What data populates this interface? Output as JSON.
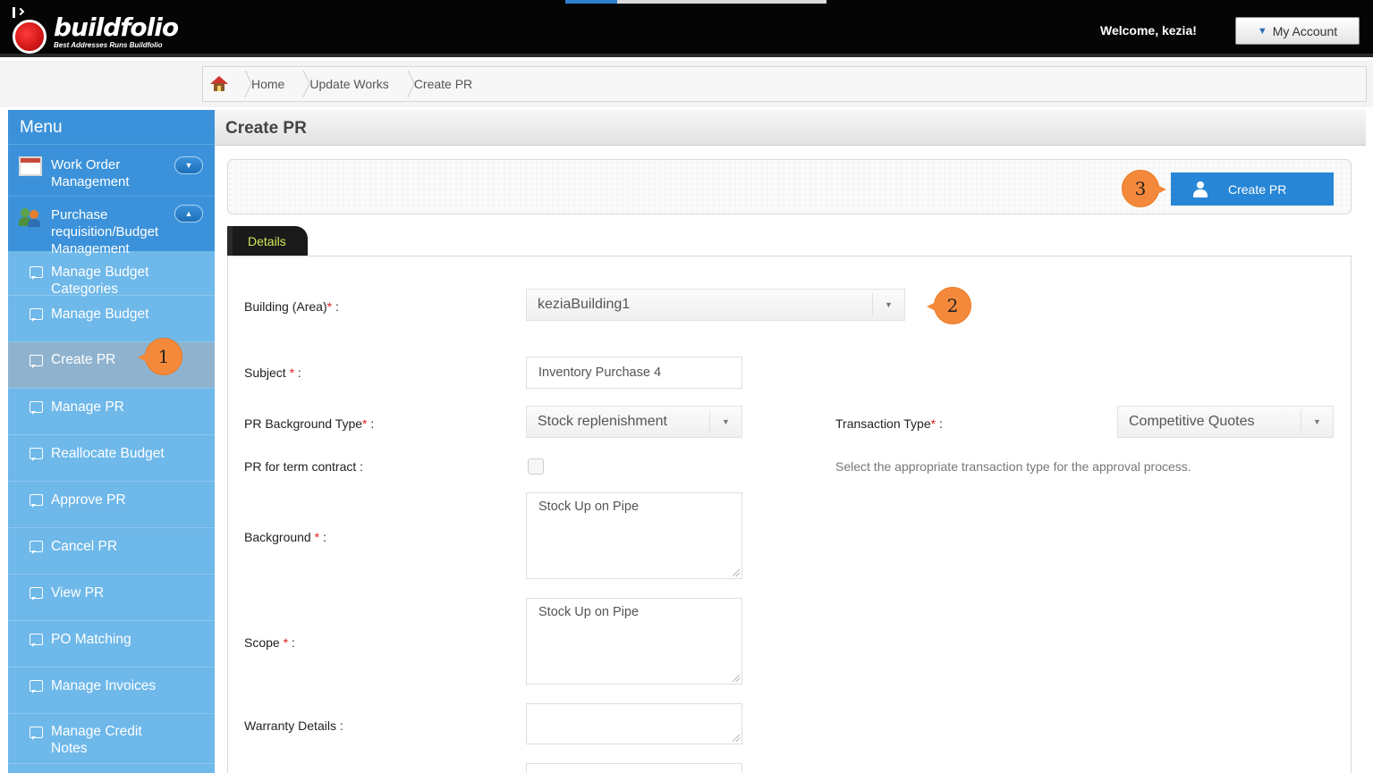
{
  "header": {
    "logo_name": "buildfolio",
    "logo_tagline": "Best Addresses Runs Buildfolio",
    "welcome": "Welcome, kezia!",
    "account_button": "My Account"
  },
  "breadcrumb": [
    "Home",
    "Update Works",
    "Create PR"
  ],
  "sidebar": {
    "title": "Menu",
    "groups": [
      {
        "label": "Work Order Management",
        "line1": "Work Order",
        "line2": "Management",
        "state": "collapsed"
      },
      {
        "label": "Purchase requisition/Budget Management",
        "line1": "Purchase",
        "line2": "requisition/Budget",
        "line3": "Management",
        "state": "expanded"
      }
    ],
    "items": [
      {
        "label": "Manage Budget Categories",
        "line1": "Manage Budget",
        "line2": "Categories"
      },
      {
        "label": "Manage Budget"
      },
      {
        "label": "Create PR",
        "active": true
      },
      {
        "label": "Manage PR"
      },
      {
        "label": "Reallocate Budget"
      },
      {
        "label": "Approve PR"
      },
      {
        "label": "Cancel PR"
      },
      {
        "label": "View PR"
      },
      {
        "label": "PO Matching"
      },
      {
        "label": "Manage Invoices"
      },
      {
        "label": "Manage Credit Notes",
        "line1": "Manage Credit",
        "line2": "Notes"
      }
    ]
  },
  "page": {
    "title": "Create PR",
    "create_button": "Create PR",
    "tab": "Details"
  },
  "form": {
    "building_label": "Building (Area)",
    "building_value": "keziaBuilding1",
    "subject_label": "Subject",
    "subject_value": "Inventory Purchase 4",
    "bg_type_label": "PR Background Type",
    "bg_type_value": "Stock replenishment",
    "transaction_label": "Transaction Type",
    "transaction_value": "Competitive Quotes",
    "term_contract_label": "PR for term contract :",
    "term_contract_checked": false,
    "transaction_hint": "Select the appropriate transaction type for the approval process.",
    "background_label": "Background",
    "background_value": "Stock Up on Pipe",
    "scope_label": "Scope",
    "scope_value": "Stock Up on Pipe",
    "warranty_label": "Warranty Details :",
    "warranty_value": ""
  },
  "annotations": {
    "c1": "1",
    "c2": "2",
    "c3": "3"
  },
  "colors": {
    "accent": "#2787d6",
    "sidebar": "#6eb8ea",
    "callout": "#f5893b",
    "required": "#e02020"
  }
}
